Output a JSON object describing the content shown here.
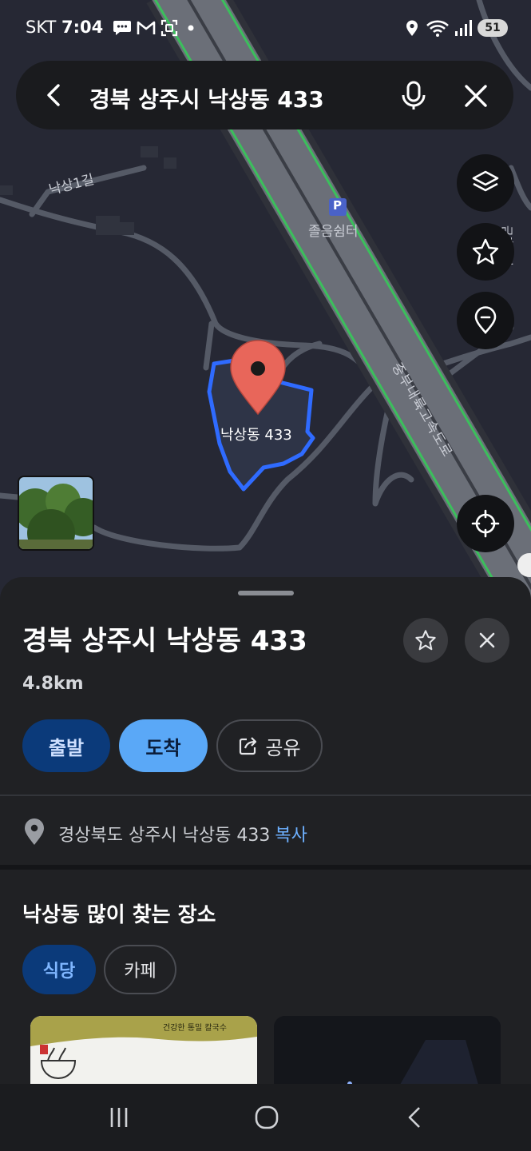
{
  "status_bar": {
    "carrier": "SKT",
    "time": "7:04",
    "battery": "51",
    "left_icons": [
      "message-icon",
      "gmail-icon",
      "screen-capture-icon",
      "dot-icon"
    ],
    "right_icons": [
      "location-icon",
      "wifi-icon",
      "signal-icon"
    ]
  },
  "search": {
    "query": "경북 상주시 낙상동 433"
  },
  "map": {
    "labels": {
      "road_naksang": "낙상1길",
      "parking": "졸음쉼터",
      "expressway": "중부내륙고속도로",
      "road_right": "금흔1길",
      "marker": "낙상동 433"
    },
    "parking_icon": "P",
    "colors": {
      "marker": "#e8665a",
      "parcel_outline": "#2f6bff",
      "expressway_edge": "#3bbf5c"
    }
  },
  "place": {
    "title": "경북 상주시 낙상동 433",
    "distance": "4.8km",
    "actions": {
      "start": "출발",
      "arrive": "도착",
      "share": "공유"
    },
    "address": "경상북도 상주시 낙상동 433",
    "copy_label": "복사"
  },
  "nearby": {
    "title": "낙상동 많이 찾는 장소",
    "chips": [
      "식당",
      "카페"
    ],
    "selected_chip": "식당",
    "card1_caption": "건강한 통밀 칼국수"
  }
}
